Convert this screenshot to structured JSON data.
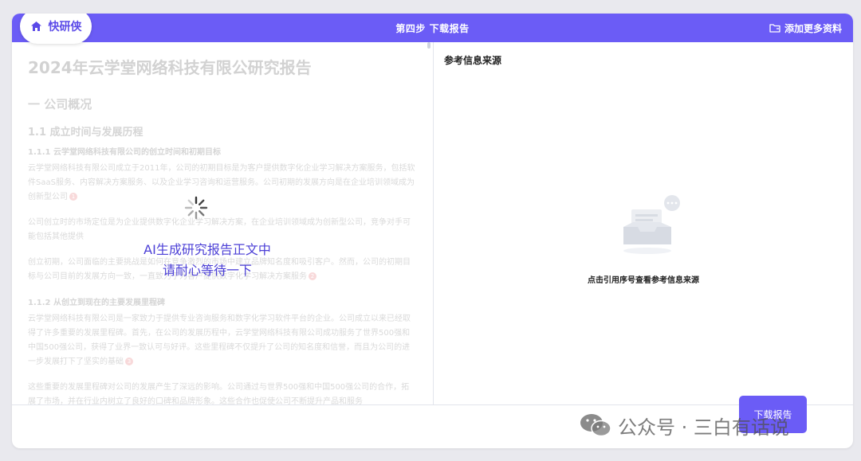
{
  "brand": {
    "name": "快研侠",
    "icon": "home-icon"
  },
  "header": {
    "step_title": "第四步 下载报告",
    "add_more_label": "添加更多资料",
    "add_more_icon": "folder-icon",
    "accent_color": "#6b5cf6"
  },
  "document": {
    "title": "2024年云学堂网络科技有限公研究报告",
    "section_1": "一 公司概况",
    "subsection_1_1": "1.1 成立时间与发展历程",
    "subsection_1_1_1": "1.1.1 云学堂网络科技有限公司的创立时间和初期目标",
    "para_1": "云学堂网络科技有限公司成立于2011年，公司的初期目标是为客户提供数字化企业学习解决方案服务，包括软件SaaS服务、内容解决方案服务、以及企业学习咨询和运营服务。公司初期的发展方向是在企业培训领域成为创新型公司",
    "para_1_cite": "1",
    "para_2": "公司创立时的市场定位是为企业提供数字化企业学习解决方案，在企业培训领域成为创新型公司，竞争对手可能包括其他提供",
    "para_3": "创立初期，公司面临的主要挑战是如何在竞争激烈的市场中建立品牌知名度和吸引客户。然而，公司的初期目标与公司目前的发展方向一致，一直致力于为客户提供数字化学习解决方案服务",
    "para_3_cite": "2",
    "subsection_1_1_2": "1.1.2 从创立到现在的主要发展里程碑",
    "para_4": "云学堂网络科技有限公司是一家致力于提供专业咨询服务和数字化学习软件平台的企业。公司成立以来已经取得了许多重要的发展里程碑。首先，在公司的发展历程中，云学堂网络科技有限公司成功服务了世界500强和中国500强公司，获得了业界一致认可与好评。这些里程碑不仅提升了公司的知名度和信誉，而且为公司的进一步发展打下了坚实的基础",
    "para_4_cite": "3",
    "para_5": "这些重要的发展里程碑对公司的发展产生了深远的影响。公司通过与世界500强和中国500强公司的合作，拓展了市场，并在行业内树立了良好的口碑和品牌形象。这些合作也促使公司不断提升产品和服务"
  },
  "loading": {
    "line1": "AI生成研究报告正文中",
    "line2": "请耐心等待一下",
    "icon": "spinner-icon",
    "text_color": "#4b3fd6"
  },
  "references": {
    "title": "参考信息来源",
    "empty_icon": "empty-inbox-icon",
    "empty_text": "点击引用序号查看参考信息来源"
  },
  "footer": {
    "download_label": "下载报告",
    "watermark_text": "公众号 · 三白有话说",
    "watermark_icon": "wechat-icon"
  }
}
